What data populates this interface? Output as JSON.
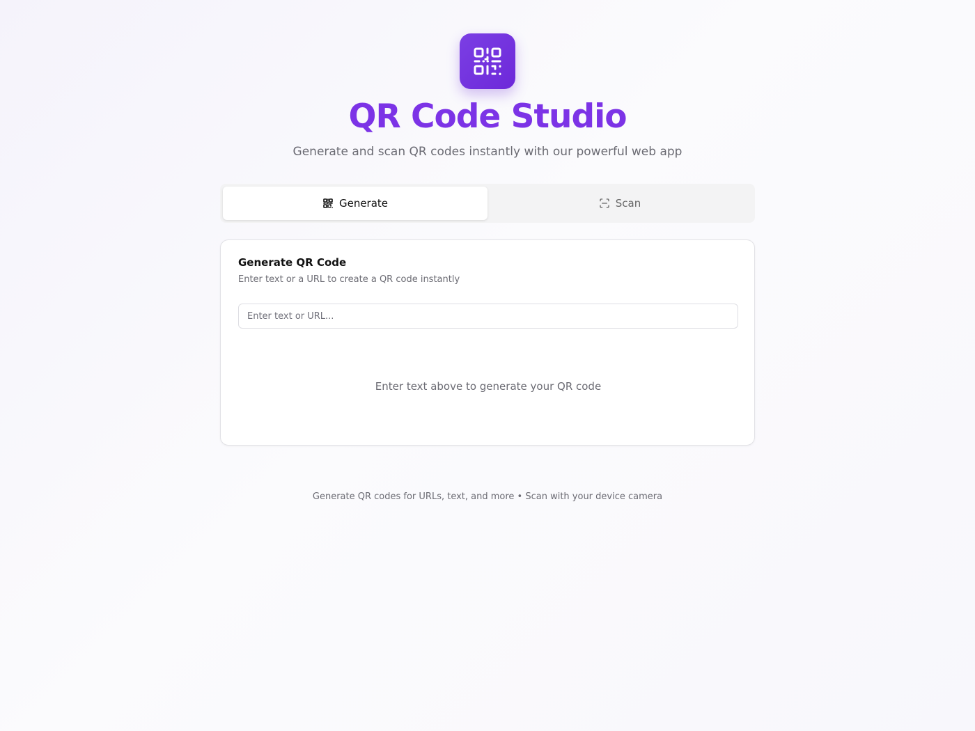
{
  "header": {
    "logo_icon": "qr-code-icon",
    "title": "QR Code Studio",
    "subtitle": "Generate and scan QR codes instantly with our powerful web app",
    "brand_color": "#7c33e6"
  },
  "tabs": [
    {
      "label": "Generate",
      "icon": "qr-code-icon",
      "active": true
    },
    {
      "label": "Scan",
      "icon": "scan-icon",
      "active": false
    }
  ],
  "generate_card": {
    "title": "Generate QR Code",
    "description": "Enter text or a URL to create a QR code instantly",
    "input": {
      "placeholder": "Enter text or URL...",
      "value": ""
    },
    "empty_message": "Enter text above to generate your QR code"
  },
  "footer": {
    "text": "Generate QR codes for URLs, text, and more • Scan with your device camera"
  }
}
